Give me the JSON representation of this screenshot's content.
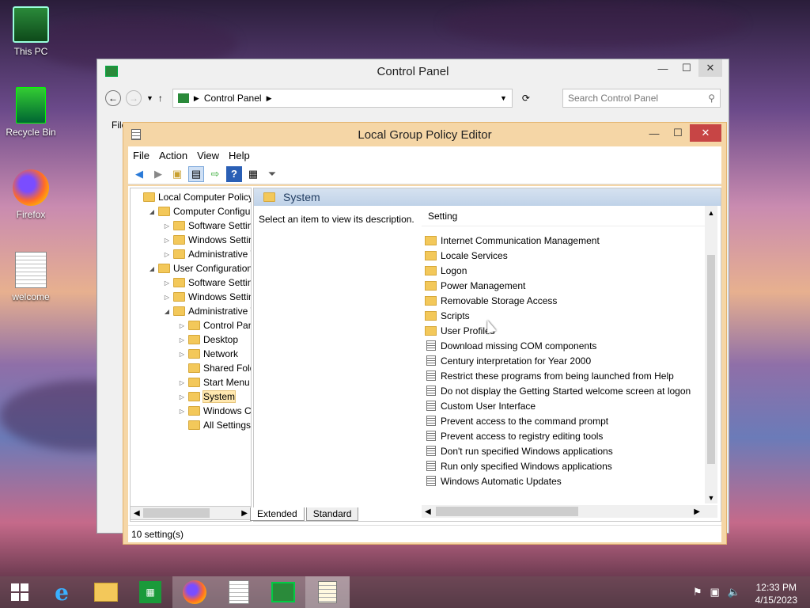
{
  "desktop": {
    "icons": [
      {
        "label": "This PC",
        "icon": "this-pc-icon"
      },
      {
        "label": "Recycle Bin",
        "icon": "recycle-bin-icon"
      },
      {
        "label": "Firefox",
        "icon": "firefox-icon"
      },
      {
        "label": "welcome",
        "icon": "text-file-icon"
      }
    ]
  },
  "control_panel": {
    "title": "Control Panel",
    "address": "Control Panel",
    "search_placeholder": "Search Control Panel",
    "menu_peek": "File"
  },
  "gpe": {
    "title": "Local Group Policy Editor",
    "menu": [
      "File",
      "Action",
      "View",
      "Help"
    ],
    "tree": [
      {
        "label": "Local Computer Policy",
        "level": 0,
        "toggle": ""
      },
      {
        "label": "Computer Configura",
        "level": 1,
        "toggle": "◢"
      },
      {
        "label": "Software Settings",
        "level": 2,
        "toggle": "▷"
      },
      {
        "label": "Windows Setting",
        "level": 2,
        "toggle": "▷"
      },
      {
        "label": "Administrative Te",
        "level": 2,
        "toggle": "▷"
      },
      {
        "label": "User Configuration",
        "level": 1,
        "toggle": "◢"
      },
      {
        "label": "Software Settings",
        "level": 2,
        "toggle": "▷"
      },
      {
        "label": "Windows Setting",
        "level": 2,
        "toggle": "▷"
      },
      {
        "label": "Administrative Te",
        "level": 2,
        "toggle": "◢"
      },
      {
        "label": "Control Panel",
        "level": 3,
        "toggle": "▷"
      },
      {
        "label": "Desktop",
        "level": 3,
        "toggle": "▷"
      },
      {
        "label": "Network",
        "level": 3,
        "toggle": "▷"
      },
      {
        "label": "Shared Folder",
        "level": 3,
        "toggle": ""
      },
      {
        "label": "Start Menu ar",
        "level": 3,
        "toggle": "▷"
      },
      {
        "label": "System",
        "level": 3,
        "toggle": "▷",
        "selected": true
      },
      {
        "label": "Windows Cor",
        "level": 3,
        "toggle": "▷"
      },
      {
        "label": "All Settings",
        "level": 3,
        "toggle": ""
      }
    ],
    "pane_header": "System",
    "description": "Select an item to view its description.",
    "column_header": "Setting",
    "items": [
      {
        "label": "Internet Communication Management",
        "type": "folder"
      },
      {
        "label": "Locale Services",
        "type": "folder"
      },
      {
        "label": "Logon",
        "type": "folder"
      },
      {
        "label": "Power Management",
        "type": "folder"
      },
      {
        "label": "Removable Storage Access",
        "type": "folder"
      },
      {
        "label": "Scripts",
        "type": "folder"
      },
      {
        "label": "User Profiles",
        "type": "folder"
      },
      {
        "label": "Download missing COM components",
        "type": "setting"
      },
      {
        "label": "Century interpretation for Year 2000",
        "type": "setting"
      },
      {
        "label": "Restrict these programs from being launched from Help",
        "type": "setting"
      },
      {
        "label": "Do not display the Getting Started welcome screen at logon",
        "type": "setting"
      },
      {
        "label": "Custom User Interface",
        "type": "setting"
      },
      {
        "label": "Prevent access to the command prompt",
        "type": "setting"
      },
      {
        "label": "Prevent access to registry editing tools",
        "type": "setting"
      },
      {
        "label": "Don't run specified Windows applications",
        "type": "setting"
      },
      {
        "label": "Run only specified Windows applications",
        "type": "setting"
      },
      {
        "label": "Windows Automatic Updates",
        "type": "setting"
      }
    ],
    "tabs": [
      "Extended",
      "Standard"
    ],
    "status": "10 setting(s)"
  },
  "taskbar": {
    "time": "12:33 PM",
    "date": "4/15/2023"
  }
}
